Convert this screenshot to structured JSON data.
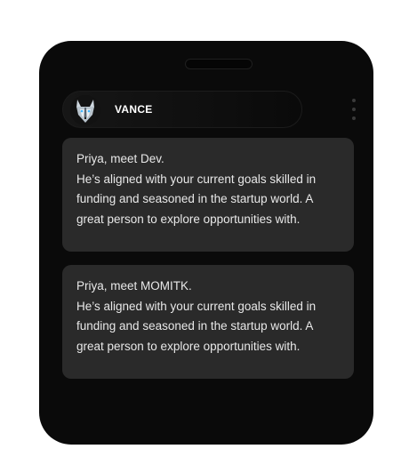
{
  "contact": {
    "name": "VANCE",
    "avatar_icon": "wolf-icon"
  },
  "messages": [
    {
      "text": "Priya, meet Dev.\nHe’s aligned with your current goals  skilled in funding and seasoned in the startup world. A great person to explore opportunities with."
    },
    {
      "text": "Priya, meet MOMITK.\nHe’s aligned with your current goals skilled in funding and seasoned in the startup world. A great person to explore opportunities with."
    }
  ],
  "colors": {
    "device": "#0a0a0a",
    "bubble": "#2a2a2a",
    "text": "#e8e8e8"
  }
}
